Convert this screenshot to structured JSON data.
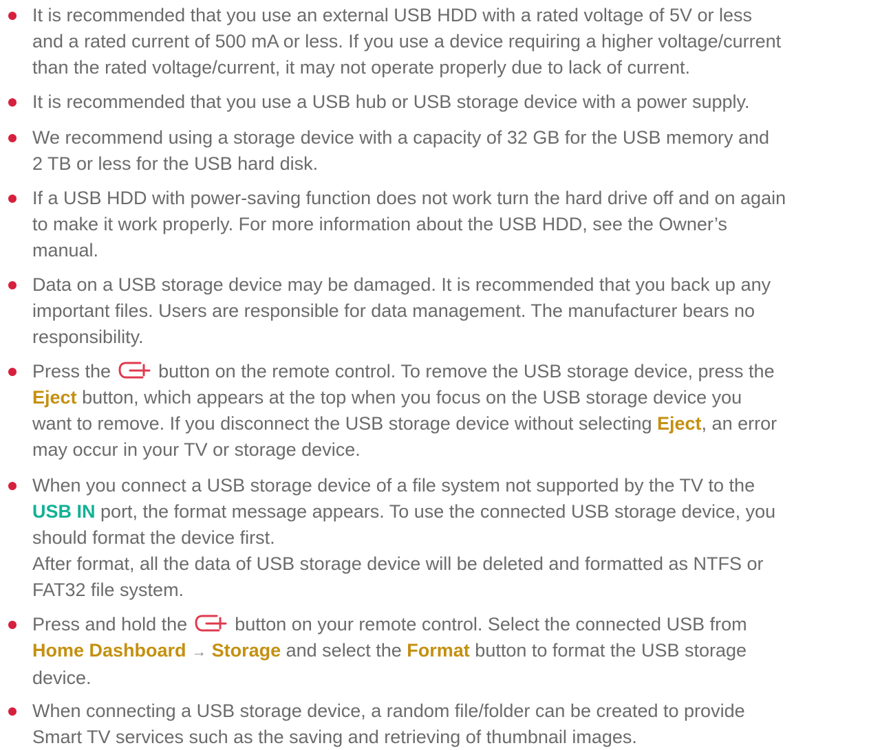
{
  "notes": [
    {
      "lines": [
        "It is recommended that you use an external USB HDD with a rated voltage of 5V or less",
        "and a rated current of 500 mA or less. If you use a device requiring a higher voltage/current",
        "than the rated voltage/current, it may not operate properly due to lack of current."
      ]
    },
    {
      "lines": [
        "It is recommended that you use a USB hub or USB storage device with a power supply."
      ]
    },
    {
      "lines": [
        "We recommend using a storage device with a capacity of 32 GB for the USB memory and",
        "2 TB or less for the USB hard disk."
      ]
    },
    {
      "lines": [
        "If a USB HDD with power-saving function does not work turn the hard drive off and on again",
        "to make it work properly. For more information about the USB HDD, see the Owner’s",
        "manual."
      ]
    },
    {
      "lines": [
        "Data on a USB storage device may be damaged. It is recommended that you back up any",
        "important files. Users are responsible for data management. The manufacturer bears no",
        "responsibility."
      ]
    },
    {
      "l1a": "Press the",
      "l1b": "button on the remote control. To remove the USB storage device, press the",
      "eject": "Eject",
      "l2b": "button, which appears at the top when you focus on the USB storage device you",
      "l3a": "want to remove. If you disconnect the USB storage device without selecting",
      "l3c": ", an error",
      "l4": "may occur in your TV or storage device."
    },
    {
      "l1": "When you connect a USB storage device of a file system not supported by the TV to the",
      "usb_in": "USB IN",
      "l2b": "port, the format message appears. To use the connected USB storage device, you",
      "l3": "should format the device first.",
      "l4": "After format, all the data of USB storage device will be deleted and formatted as NTFS or",
      "l5": "FAT32 file system."
    },
    {
      "l1a": "Press and hold the",
      "l1b": "button on your remote control. Select the connected USB from",
      "home_dashboard": "Home Dashboard",
      "arrow": "→",
      "storage": "Storage",
      "l2c": "and select the",
      "format": "Format",
      "l2e": "button to format the USB storage",
      "l3": "device."
    },
    {
      "lines": [
        "When connecting a USB storage device, a random file/folder can be created to provide",
        "Smart TV services such as the saving and retrieving of thumbnail images."
      ]
    }
  ],
  "icon_names": {
    "input": "input-source-icon"
  },
  "colors": {
    "bullet": "#d6203d",
    "highlight": "#c49010",
    "port": "#12b195",
    "text": "#6b6b6b",
    "icon": "#e03a4e"
  }
}
